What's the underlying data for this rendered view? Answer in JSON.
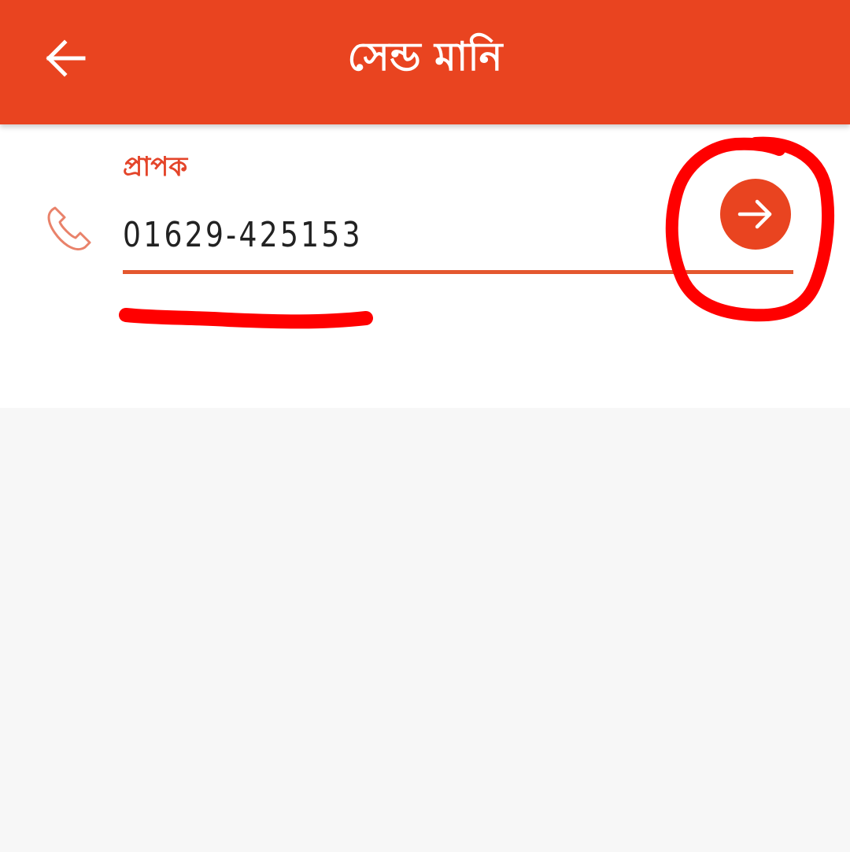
{
  "header": {
    "title": "সেন্ড মানি",
    "back_icon": "arrow-left-icon"
  },
  "form": {
    "recipient_label": "প্রাপক",
    "phone_icon": "phone-icon",
    "phone_value": "01629-425153",
    "submit_icon": "arrow-right-icon"
  },
  "colors": {
    "brand": "#e94420",
    "label": "#e4452a",
    "underline": "#e4572e",
    "annotation": "#ff0000",
    "background": "#f7f7f7"
  },
  "annotations": {
    "circle_icon": "hand-drawn-circle",
    "underline_icon": "hand-drawn-underline"
  }
}
